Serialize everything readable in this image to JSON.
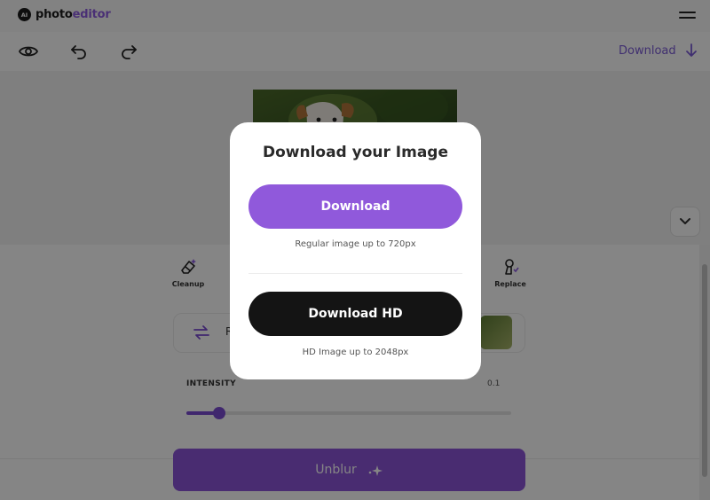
{
  "app": {
    "logo_badge": "AI",
    "logo_name": "photo",
    "logo_accent": "editor",
    "accent_color": "#8e5ce0"
  },
  "toolbar": {
    "preview_icon": "eye-icon",
    "undo_icon": "undo-icon",
    "redo_icon": "redo-icon",
    "download_label": "Download",
    "download_icon": "arrow-down-icon"
  },
  "tools": [
    {
      "label": "Cleanup",
      "icon": "eraser-icon"
    },
    {
      "label": "Replace",
      "icon": "brush-icon"
    }
  ],
  "panel": {
    "label_fragment": "R",
    "swap_icon": "swap-icon"
  },
  "intensity": {
    "label": "INTENSITY",
    "value": "0.1",
    "fraction": 0.1
  },
  "unblur_button": {
    "label": "Unblur",
    "icon": "sparkle-icon",
    "color": "#8d55d9"
  },
  "modal": {
    "title": "Download your Image",
    "download": {
      "label": "Download",
      "subtext": "Regular image up to 720px",
      "color": "#9059db"
    },
    "download_hd": {
      "label": "Download HD",
      "subtext": "HD Image up to 2048px",
      "color": "#141414"
    }
  }
}
